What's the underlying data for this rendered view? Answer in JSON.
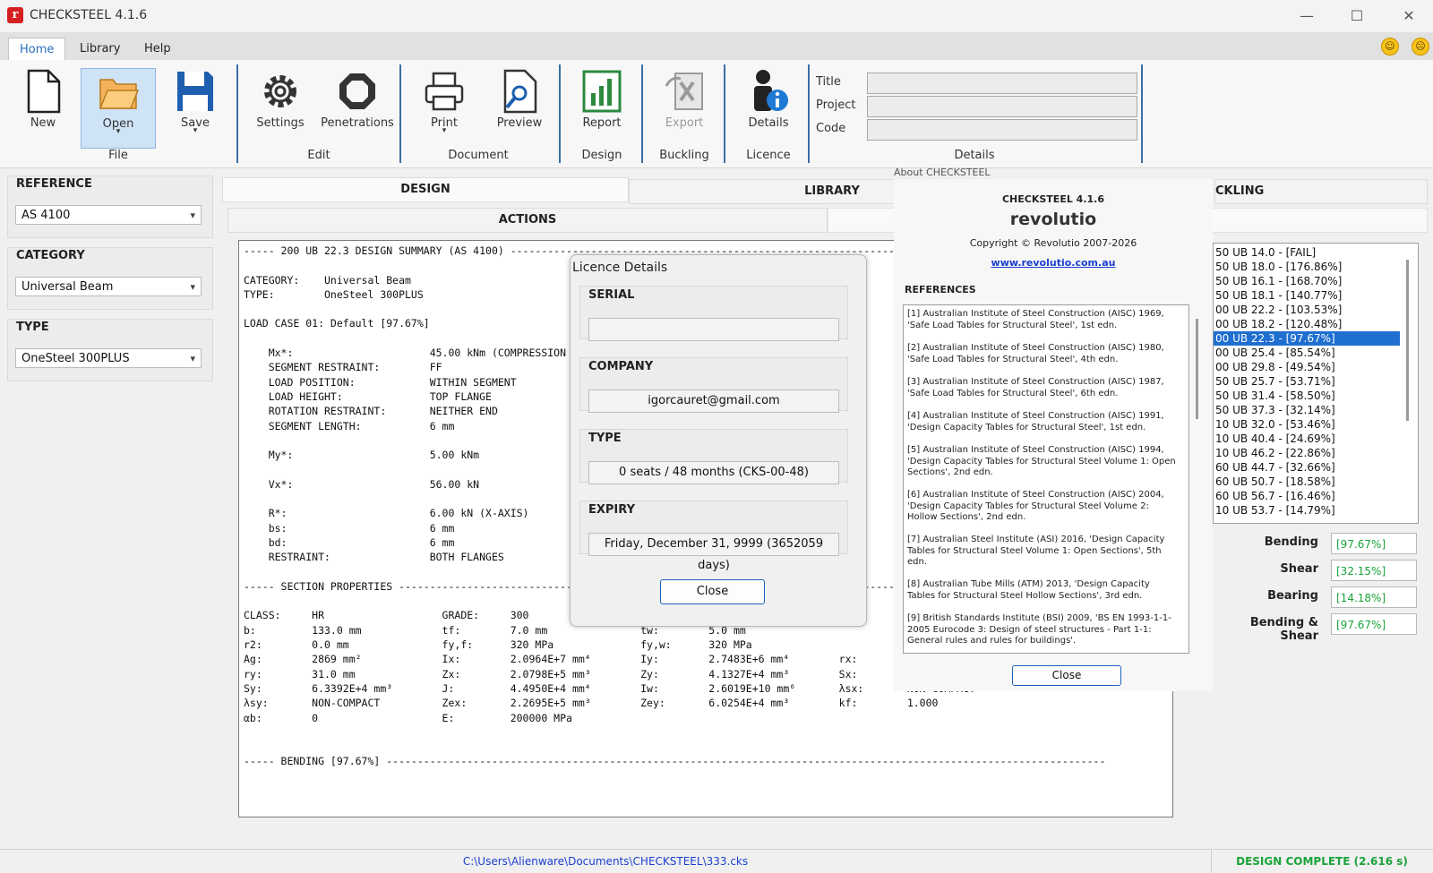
{
  "app": {
    "title": "CHECKSTEEL 4.1.6"
  },
  "window_controls": {
    "minimize": "—",
    "maximize": "☐",
    "close": "✕"
  },
  "menu": {
    "tabs": [
      "Home",
      "Library",
      "Help"
    ],
    "happy": "☺",
    "sad": "☹"
  },
  "ribbon": {
    "buttons": {
      "new": "New",
      "open": "Open",
      "save": "Save",
      "settings": "Settings",
      "penetrations": "Penetrations",
      "print": "Print",
      "preview": "Preview",
      "report": "Report",
      "export": "Export",
      "details": "Details"
    },
    "groups": {
      "file": "File",
      "edit": "Edit",
      "document": "Document",
      "design": "Design",
      "buckling": "Buckling",
      "licence": "Licence",
      "details": "Details"
    },
    "detail_fields": {
      "title": "Title",
      "project": "Project",
      "code": "Code"
    }
  },
  "left": {
    "reference": {
      "label": "REFERENCE",
      "value": "AS 4100"
    },
    "category": {
      "label": "CATEGORY",
      "value": "Universal Beam"
    },
    "type": {
      "label": "TYPE",
      "value": "OneSteel 300PLUS"
    }
  },
  "tabs": {
    "design": "DESIGN",
    "library": "LIBRARY",
    "buckling": "CKLING",
    "actions": "ACTIONS"
  },
  "output_lines": [
    "----- 200 UB 22.3 DESIGN SUMMARY (AS 4100) -----------------------------------------------------------------------------------------------",
    "",
    "CATEGORY:    Universal Beam",
    "TYPE:        OneSteel 300PLUS",
    "",
    "LOAD CASE 01: Default [97.67%]",
    "",
    "    Mx*:                      45.00 kNm (COMPRESSION IN TOP FLANGE)",
    "    SEGMENT RESTRAINT:        FF",
    "    LOAD POSITION:            WITHIN SEGMENT",
    "    LOAD HEIGHT:              TOP FLANGE",
    "    ROTATION RESTRAINT:       NEITHER END",
    "    SEGMENT LENGTH:           6 mm",
    "",
    "    My*:                      5.00 kNm",
    "",
    "    Vx*:                      56.00 kN",
    "",
    "    R*:                       6.00 kN (X-AXIS)",
    "    bs:                       6 mm",
    "    bd:                       6 mm",
    "    RESTRAINT:                BOTH FLANGES",
    "",
    "----- SECTION PROPERTIES ------------------------------------------------------------------------------------------------------------------",
    "",
    "CLASS:     HR                   GRADE:     300                  MASS:      22.5 kg/m",
    "b:         133.0 mm             tf:        7.0 mm               tw:        5.0 mm",
    "r2:        0.0 mm               fy,f:      320 MPa              fy,w:      320 MPa",
    "Ag:        2869 mm²             Ix:        2.0964E+7 mm⁴        Iy:        2.7483E+6 mm⁴        rx:        85.5 mm",
    "ry:        31.0 mm              Zx:        2.0798E+5 mm³        Zy:        4.1327E+4 mm³        Sx:        2.3146E+5 mm³",
    "Sy:        6.3392E+4 mm³        J:         4.4950E+4 mm⁴        Iw:        2.6019E+10 mm⁶       λsx:       NON-COMPACT",
    "λsy:       NON-COMPACT          Zex:       2.2695E+5 mm³        Zey:       6.0254E+4 mm³        kf:        1.000",
    "αb:        0                    E:         200000 MPa",
    "",
    "",
    "----- BENDING [97.67%] --------------------------------------------------------------------------------------------------------------------"
  ],
  "licence_dialog": {
    "title": "Licence Details",
    "serial": {
      "label": "SERIAL",
      "value": ""
    },
    "company": {
      "label": "COMPANY",
      "value": "igorcauret@gmail.com"
    },
    "type": {
      "label": "TYPE",
      "value": "0 seats / 48 months (CKS-00-48)"
    },
    "expiry": {
      "label": "EXPIRY",
      "value": "Friday, December 31, 9999 (3652059 days)"
    },
    "close": "Close"
  },
  "about_dialog": {
    "title": "About CHECKSTEEL",
    "product": "CHECKSTEEL 4.1.6",
    "brand": "revolutio",
    "copyright": "Copyright © Revolutio 2007-2026",
    "url": "www.revolutio.com.au",
    "references_label": "REFERENCES",
    "references": [
      "[1] Australian Institute of Steel Construction (AISC) 1969, 'Safe Load Tables for Structural Steel', 1st edn.",
      "[2] Australian Institute of Steel Construction (AISC) 1980, 'Safe Load Tables for Structural Steel', 4th edn.",
      "[3] Australian Institute of Steel Construction (AISC) 1987, 'Safe Load Tables for Structural Steel', 6th edn.",
      "[4] Australian Institute of Steel Construction (AISC) 1991, 'Design Capacity Tables for Structural Steel', 1st edn.",
      "[5] Australian Institute of Steel Construction (AISC) 1994, 'Design Capacity Tables for Structural Steel Volume 1: Open Sections', 2nd edn.",
      "[6] Australian Institute of Steel Construction (AISC) 2004, 'Design Capacity Tables for Structural Steel Volume 2: Hollow Sections', 2nd edn.",
      "[7] Australian Steel Institute (ASI) 2016, 'Design Capacity Tables for Structural Steel Volume 1: Open Sections', 5th edn.",
      "[8] Australian Tube Mills (ATM) 2013, 'Design Capacity Tables for Structural Steel Hollow Sections', 3rd edn.",
      "[9] British Standards Institute (BSI) 2009, 'BS EN 1993-1-1-2005 Eurocode 3: Design of steel structures - Part 1-1: General rules and rules for buildings'."
    ],
    "close": "Close"
  },
  "results": [
    "50 UB 14.0 - [FAIL]",
    "50 UB 18.0 - [176.86%]",
    "50 UB 16.1 - [168.70%]",
    "50 UB 18.1 - [140.77%]",
    "00 UB 22.2 - [103.53%]",
    "00 UB 18.2 - [120.48%]",
    "00 UB 22.3 - [97.67%]",
    "00 UB 25.4 - [85.54%]",
    "00 UB 29.8 - [49.54%]",
    "50 UB 25.7 - [53.71%]",
    "50 UB 31.4 - [58.50%]",
    "50 UB 37.3 - [32.14%]",
    "10 UB 32.0 - [53.46%]",
    "10 UB 40.4 - [24.69%]",
    "10 UB 46.2 - [22.86%]",
    "60 UB 44.7 - [32.66%]",
    "60 UB 50.7 - [18.58%]",
    "60 UB 56.7 - [16.46%]",
    "10 UB 53.7 - [14.79%]"
  ],
  "results_selected_index": 6,
  "stats": [
    {
      "label": "Bending",
      "value": "[97.67%]"
    },
    {
      "label": "Shear",
      "value": "[32.15%]"
    },
    {
      "label": "Bearing",
      "value": "[14.18%]"
    },
    {
      "label": "Bending & Shear",
      "value": "[97.67%]"
    }
  ],
  "status": {
    "path": "C:\\Users\\Alienware\\Documents\\CHECKSTEEL\\333.cks",
    "result": "DESIGN COMPLETE (2.616 s)"
  },
  "colors": {
    "accent": "#2a6fbf",
    "pass": "#1aa33a",
    "selection": "#1f6fd0",
    "brand_red": "#d42020"
  }
}
